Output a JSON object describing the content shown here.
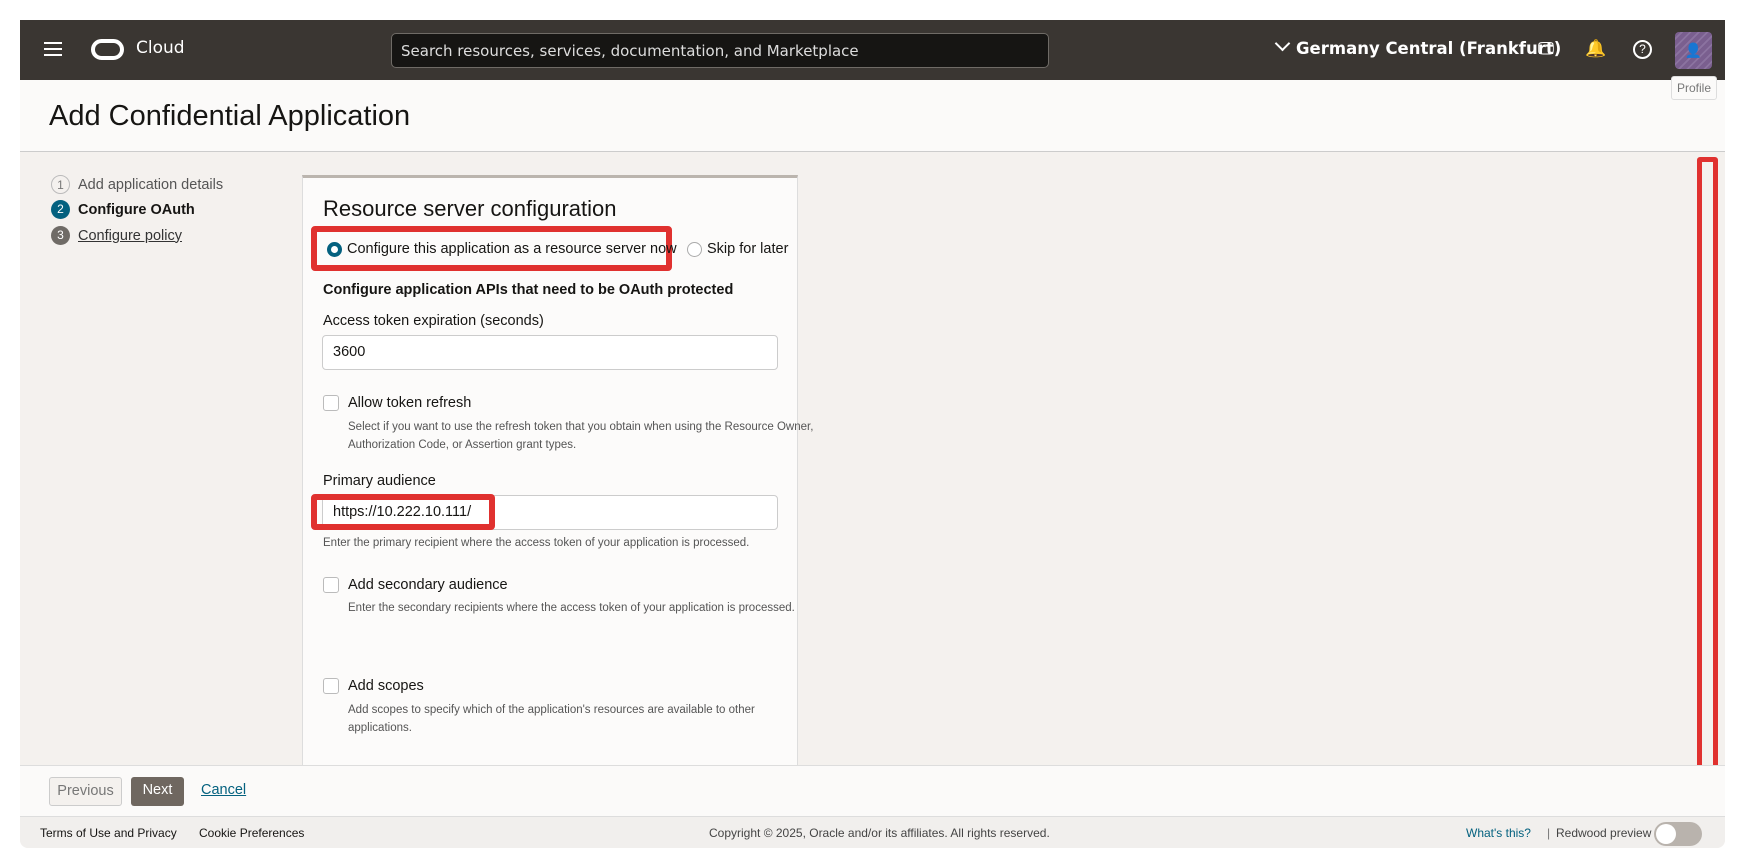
{
  "header": {
    "brand": "Cloud",
    "search_placeholder": "Search resources, services, documentation, and Marketplace",
    "region": "Germany Central (Frankfurt)",
    "profile_tooltip": "Profile"
  },
  "page": {
    "title": "Add Confidential Application"
  },
  "steps": [
    {
      "num": "1",
      "label": "Add application details"
    },
    {
      "num": "2",
      "label": "Configure OAuth"
    },
    {
      "num": "3",
      "label": "Configure policy"
    }
  ],
  "form": {
    "heading": "Resource server configuration",
    "radio_configure": "Configure this application as a resource server now",
    "radio_skip": "Skip for later",
    "section": "Configure application APIs that need to be OAuth protected",
    "token_label": "Access token expiration (seconds)",
    "token_value": "3600",
    "allow_refresh": "Allow token refresh",
    "allow_refresh_help": "Select if you want to use the refresh token that you obtain when using the Resource Owner, Authorization Code, or Assertion grant types.",
    "primary_label": "Primary audience",
    "primary_value": "https://10.222.10.111/",
    "primary_help": "Enter the primary recipient where the access token of your application is processed.",
    "secondary": "Add secondary audience",
    "secondary_help": "Enter the secondary recipients where the access token of your application is processed.",
    "scopes": "Add scopes",
    "scopes_help": "Add scopes to specify which of the application's resources are available to other applications."
  },
  "actions": {
    "previous": "Previous",
    "next": "Next",
    "cancel": "Cancel"
  },
  "footer": {
    "terms": "Terms of Use and Privacy",
    "cookies": "Cookie Preferences",
    "copyright": "Copyright © 2025, Oracle and/or its affiliates. All rights reserved.",
    "whats_this": "What's this?",
    "separator": "|",
    "redwood": "Redwood preview"
  },
  "colors": {
    "header": "#3a3632",
    "accent": "#04617f",
    "highlight": "#e0312f"
  }
}
